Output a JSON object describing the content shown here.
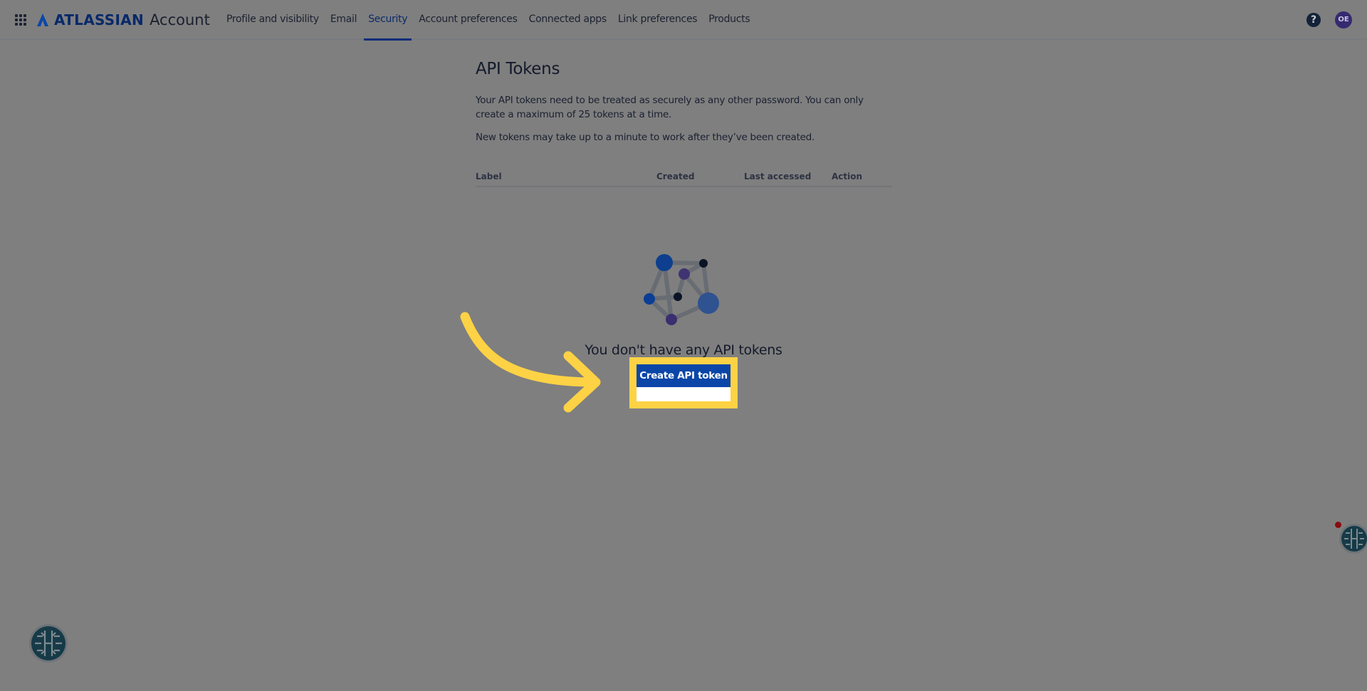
{
  "header": {
    "brand": "ATLASSIAN",
    "product": "Account",
    "nav": [
      {
        "label": "Profile and visibility",
        "active": false
      },
      {
        "label": "Email",
        "active": false
      },
      {
        "label": "Security",
        "active": true
      },
      {
        "label": "Account preferences",
        "active": false
      },
      {
        "label": "Connected apps",
        "active": false
      },
      {
        "label": "Link preferences",
        "active": false
      },
      {
        "label": "Products",
        "active": false
      }
    ],
    "help_label": "?",
    "avatar_initials": "OE"
  },
  "main": {
    "title": "API Tokens",
    "description": "Your API tokens need to be treated as securely as any other password. You can only create a maximum of 25 tokens at a time.",
    "note": "New tokens may take up to a minute to work after they’ve been created.",
    "table": {
      "columns": [
        "Label",
        "Created",
        "Last accessed",
        "Action"
      ],
      "rows": []
    },
    "empty_state": {
      "title": "You don't have any API tokens",
      "button_label": "Create API token"
    }
  },
  "colors": {
    "overlay_bg": "#7f7f7f",
    "brand_blue": "#0a46a8",
    "highlight_yellow": "#fdd245",
    "avatar_bg": "#352a70"
  }
}
